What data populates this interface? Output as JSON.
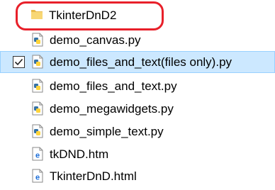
{
  "explorer": {
    "folder": {
      "name": "TkinterDnD2",
      "icon": "folder-icon"
    },
    "files": [
      {
        "name": "demo_canvas.py",
        "icon": "python-file-icon",
        "selected": false
      },
      {
        "name": "demo_files_and_text(files only).py",
        "icon": "python-file-icon",
        "selected": true
      },
      {
        "name": "demo_files_and_text.py",
        "icon": "python-file-icon",
        "selected": false
      },
      {
        "name": "demo_megawidgets.py",
        "icon": "python-file-icon",
        "selected": false
      },
      {
        "name": "demo_simple_text.py",
        "icon": "python-file-icon",
        "selected": false
      },
      {
        "name": "tkDND.htm",
        "icon": "edge-html-icon",
        "selected": false
      },
      {
        "name": "TkinterDnD.html",
        "icon": "edge-html-icon",
        "selected": false
      }
    ]
  },
  "colors": {
    "selection_bg": "#cce8ff",
    "selection_border": "#99d1ff",
    "annotation_ring": "#e8202a",
    "folder_yellow": "#f8d775",
    "python_blue": "#3572a5",
    "python_yellow": "#ffd43b",
    "edge_blue": "#1e6fd9"
  }
}
